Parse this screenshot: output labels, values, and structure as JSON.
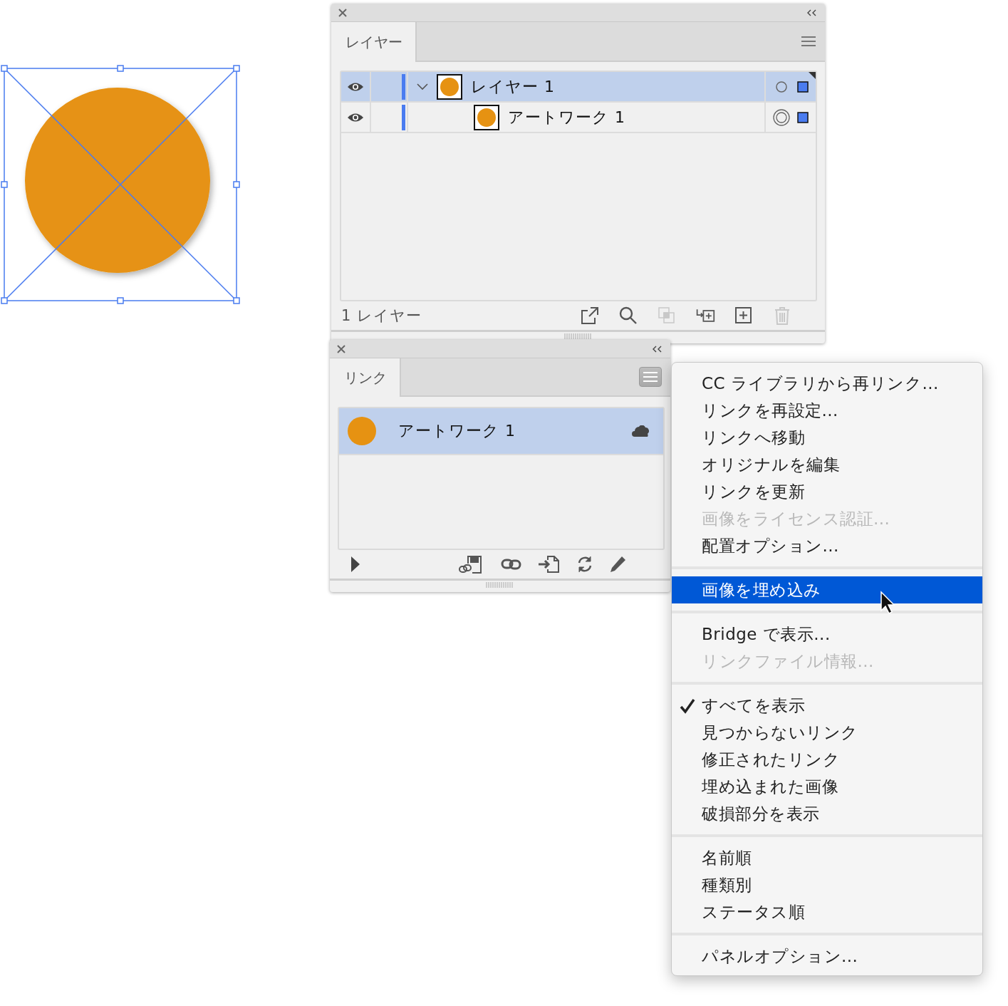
{
  "artwork": {
    "selected": true
  },
  "layers_panel": {
    "tab": "レイヤー",
    "rows": [
      {
        "name": "レイヤー 1",
        "visible": true,
        "selected": true,
        "expanded": true,
        "targeted": false,
        "children": [
          {
            "name": "アートワーク 1",
            "visible": true,
            "selected": false,
            "targeted": true
          }
        ]
      }
    ],
    "footer": "1 レイヤー",
    "toolbar": [
      {
        "kind": "export",
        "disabled": false
      },
      {
        "kind": "search",
        "disabled": false
      },
      {
        "kind": "mask",
        "disabled": true
      },
      {
        "kind": "sublayer",
        "disabled": false
      },
      {
        "kind": "new",
        "disabled": false
      },
      {
        "kind": "trash",
        "disabled": true
      }
    ]
  },
  "links_panel": {
    "tab": "リンク",
    "items": [
      {
        "name": "アートワーク 1",
        "selected": true
      }
    ],
    "toolbar": [
      {
        "kind": "relink-library",
        "disabled": false
      },
      {
        "kind": "link",
        "disabled": false
      },
      {
        "kind": "goto",
        "disabled": false
      },
      {
        "kind": "refresh",
        "disabled": false
      },
      {
        "kind": "edit",
        "disabled": false
      }
    ]
  },
  "menu": {
    "sections": [
      {
        "items": [
          {
            "label": "CC ライブラリから再リンク...",
            "disabled": false,
            "selected": false,
            "checked": false
          },
          {
            "label": "リンクを再設定...",
            "disabled": false,
            "selected": false,
            "checked": false
          },
          {
            "label": "リンクへ移動",
            "disabled": false,
            "selected": false,
            "checked": false
          },
          {
            "label": "オリジナルを編集",
            "disabled": false,
            "selected": false,
            "checked": false
          },
          {
            "label": "リンクを更新",
            "disabled": false,
            "selected": false,
            "checked": false
          },
          {
            "label": "画像をライセンス認証...",
            "disabled": true,
            "selected": false,
            "checked": false
          },
          {
            "label": "配置オプション...",
            "disabled": false,
            "selected": false,
            "checked": false
          }
        ]
      },
      {
        "items": [
          {
            "label": "画像を埋め込み",
            "disabled": false,
            "selected": true,
            "checked": false
          }
        ]
      },
      {
        "items": [
          {
            "label": "Bridge で表示...",
            "disabled": false,
            "selected": false,
            "checked": false
          },
          {
            "label": "リンクファイル情報...",
            "disabled": true,
            "selected": false,
            "checked": false
          }
        ]
      },
      {
        "items": [
          {
            "label": "すべてを表示",
            "disabled": false,
            "selected": false,
            "checked": true
          },
          {
            "label": "見つからないリンク",
            "disabled": false,
            "selected": false,
            "checked": false
          },
          {
            "label": "修正されたリンク",
            "disabled": false,
            "selected": false,
            "checked": false
          },
          {
            "label": "埋め込まれた画像",
            "disabled": false,
            "selected": false,
            "checked": false
          },
          {
            "label": "破損部分を表示",
            "disabled": false,
            "selected": false,
            "checked": false
          }
        ]
      },
      {
        "items": [
          {
            "label": "名前順",
            "disabled": false,
            "selected": false,
            "checked": false
          },
          {
            "label": "種類別",
            "disabled": false,
            "selected": false,
            "checked": false
          },
          {
            "label": "ステータス順",
            "disabled": false,
            "selected": false,
            "checked": false
          }
        ]
      },
      {
        "items": [
          {
            "label": "パネルオプション...",
            "disabled": false,
            "selected": false,
            "checked": false
          }
        ]
      }
    ]
  }
}
